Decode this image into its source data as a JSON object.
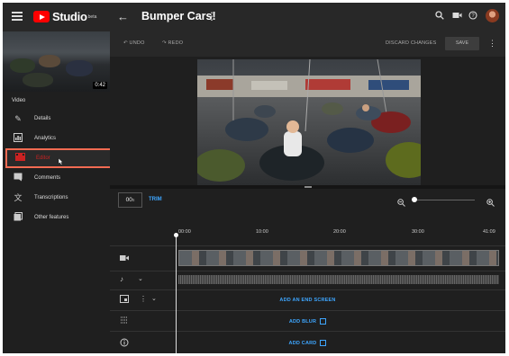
{
  "app": {
    "logo_text": "Studio",
    "logo_badge": "beta"
  },
  "header": {
    "title": "Bumper Cars!"
  },
  "sidebar": {
    "duration": "0:42",
    "section_label": "Video",
    "items": [
      {
        "label": "Details",
        "icon": "pencil-icon"
      },
      {
        "label": "Analytics",
        "icon": "analytics-icon"
      },
      {
        "label": "Editor",
        "icon": "editor-icon"
      },
      {
        "label": "Comments",
        "icon": "comments-icon"
      },
      {
        "label": "Transcriptions",
        "icon": "translate-icon"
      },
      {
        "label": "Other features",
        "icon": "other-features-icon"
      }
    ]
  },
  "toolbar": {
    "undo": "UNDO",
    "redo": "REDO",
    "discard": "DISCARD CHANGES",
    "save": "SAVE"
  },
  "editor": {
    "time_value": "00",
    "time_suffix": "s",
    "trim": "TRIM",
    "ruler": [
      "00:00",
      "10:00",
      "20:00",
      "30:00",
      "41:09"
    ],
    "end_screen": "ADD AN END SCREEN",
    "add_blur": "ADD BLUR",
    "add_card": "ADD CARD"
  },
  "colors": {
    "accent": "#3ea6ff",
    "brand": "#ff0000",
    "highlight": "#f36b52"
  }
}
